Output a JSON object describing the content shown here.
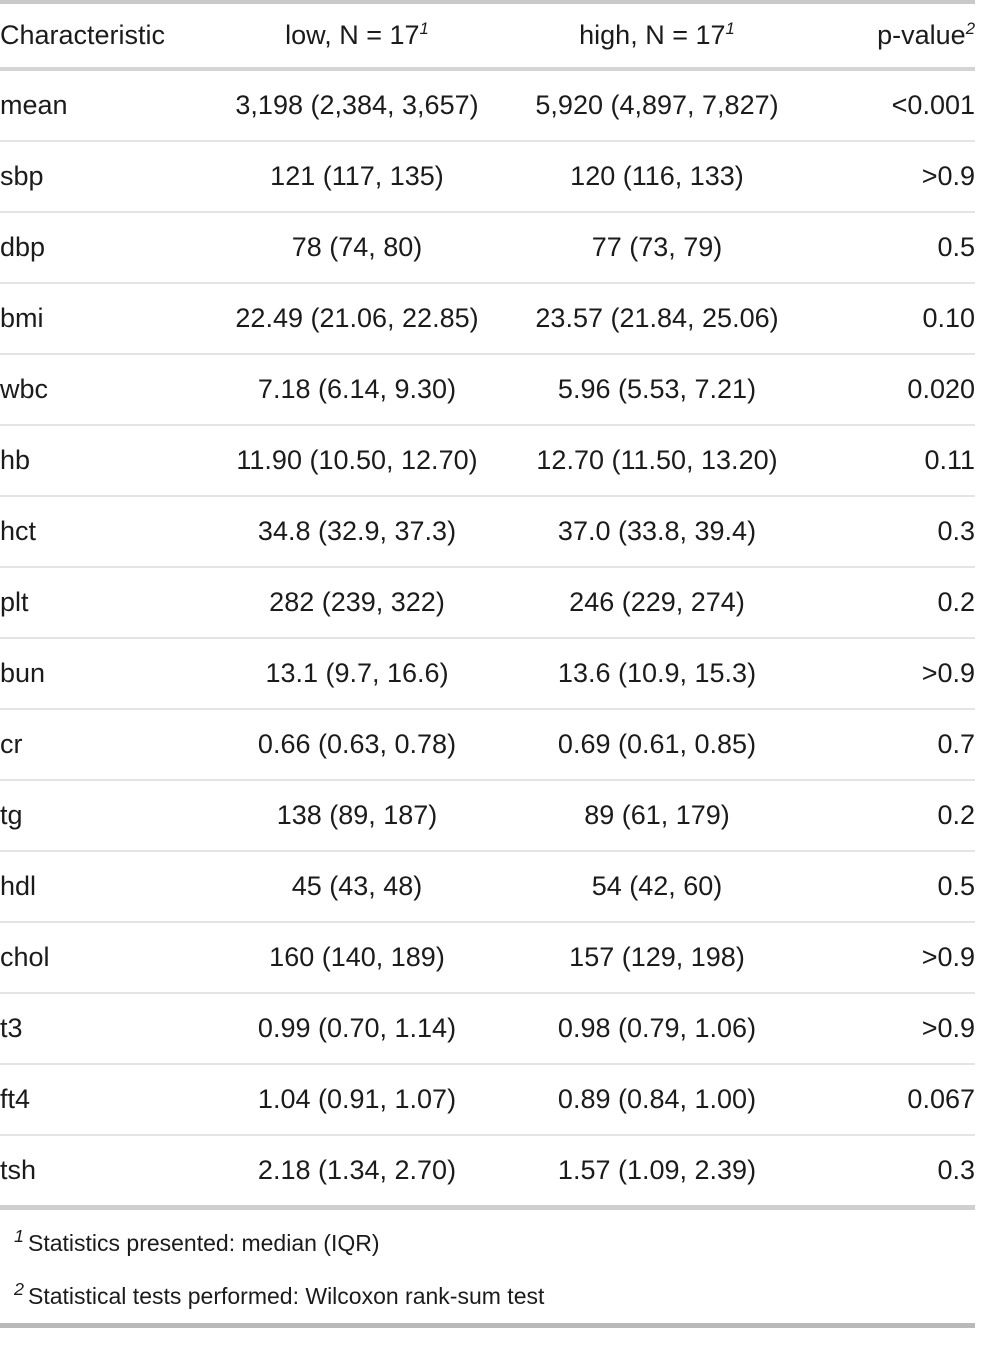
{
  "table": {
    "columns": [
      {
        "key": "characteristic",
        "label": "Characteristic",
        "footnote_marker": "",
        "align": "left"
      },
      {
        "key": "low",
        "label": "low, N = 17",
        "footnote_marker": "1",
        "align": "center"
      },
      {
        "key": "high",
        "label": "high, N = 17",
        "footnote_marker": "1",
        "align": "center"
      },
      {
        "key": "pvalue",
        "label": "p-value",
        "footnote_marker": "2",
        "align": "right"
      }
    ],
    "rows": [
      {
        "characteristic": "mean",
        "low": "3,198 (2,384, 3,657)",
        "high": "5,920 (4,897, 7,827)",
        "pvalue": "<0.001"
      },
      {
        "characteristic": "sbp",
        "low": "121 (117, 135)",
        "high": "120 (116, 133)",
        "pvalue": ">0.9"
      },
      {
        "characteristic": "dbp",
        "low": "78 (74, 80)",
        "high": "77 (73, 79)",
        "pvalue": "0.5"
      },
      {
        "characteristic": "bmi",
        "low": "22.49 (21.06, 22.85)",
        "high": "23.57 (21.84, 25.06)",
        "pvalue": "0.10"
      },
      {
        "characteristic": "wbc",
        "low": "7.18 (6.14, 9.30)",
        "high": "5.96 (5.53, 7.21)",
        "pvalue": "0.020"
      },
      {
        "characteristic": "hb",
        "low": "11.90 (10.50, 12.70)",
        "high": "12.70 (11.50, 13.20)",
        "pvalue": "0.11"
      },
      {
        "characteristic": "hct",
        "low": "34.8 (32.9, 37.3)",
        "high": "37.0 (33.8, 39.4)",
        "pvalue": "0.3"
      },
      {
        "characteristic": "plt",
        "low": "282 (239, 322)",
        "high": "246 (229, 274)",
        "pvalue": "0.2"
      },
      {
        "characteristic": "bun",
        "low": "13.1 (9.7, 16.6)",
        "high": "13.6 (10.9, 15.3)",
        "pvalue": ">0.9"
      },
      {
        "characteristic": "cr",
        "low": "0.66 (0.63, 0.78)",
        "high": "0.69 (0.61, 0.85)",
        "pvalue": "0.7"
      },
      {
        "characteristic": "tg",
        "low": "138 (89, 187)",
        "high": "89 (61, 179)",
        "pvalue": "0.2"
      },
      {
        "characteristic": "hdl",
        "low": "45 (43, 48)",
        "high": "54 (42, 60)",
        "pvalue": "0.5"
      },
      {
        "characteristic": "chol",
        "low": "160 (140, 189)",
        "high": "157 (129, 198)",
        "pvalue": ">0.9"
      },
      {
        "characteristic": "t3",
        "low": "0.99 (0.70, 1.14)",
        "high": "0.98 (0.79, 1.06)",
        "pvalue": ">0.9"
      },
      {
        "characteristic": "ft4",
        "low": "1.04 (0.91, 1.07)",
        "high": "0.89 (0.84, 1.00)",
        "pvalue": "0.067"
      },
      {
        "characteristic": "tsh",
        "low": "2.18 (1.34, 2.70)",
        "high": "1.57 (1.09, 2.39)",
        "pvalue": "0.3"
      }
    ],
    "footnotes": [
      {
        "marker": "1",
        "text": "Statistics presented: median (IQR)"
      },
      {
        "marker": "2",
        "text": "Statistical tests performed: Wilcoxon rank-sum test"
      }
    ]
  }
}
